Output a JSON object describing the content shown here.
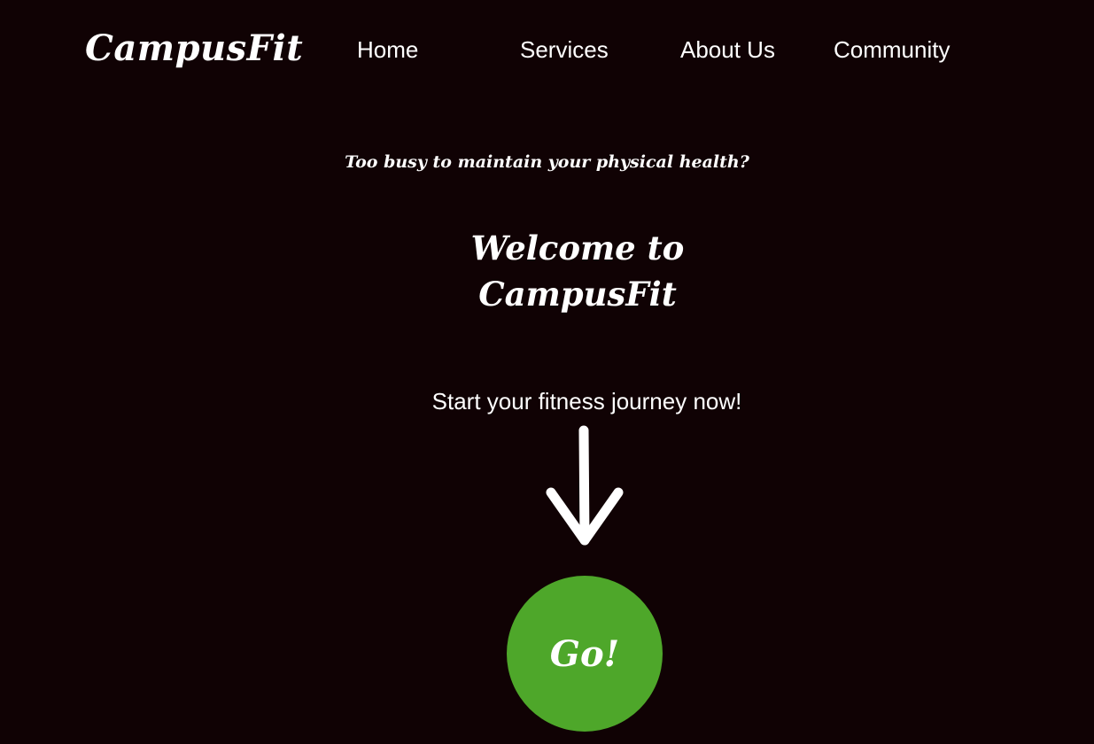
{
  "header": {
    "logo": "CampusFit",
    "nav": [
      {
        "label": "Home"
      },
      {
        "label": "Services"
      },
      {
        "label": "About Us"
      },
      {
        "label": "Community"
      }
    ]
  },
  "hero": {
    "tagline": "Too busy to maintain your physical health?",
    "title": "Welcome to CampusFit",
    "cta_text": "Start your fitness journey now!",
    "arrow_icon": "arrow-down-icon",
    "go_label": "Go!"
  },
  "colors": {
    "background": "#100204",
    "text": "#ffffff",
    "go_button": "#4ea72a"
  }
}
